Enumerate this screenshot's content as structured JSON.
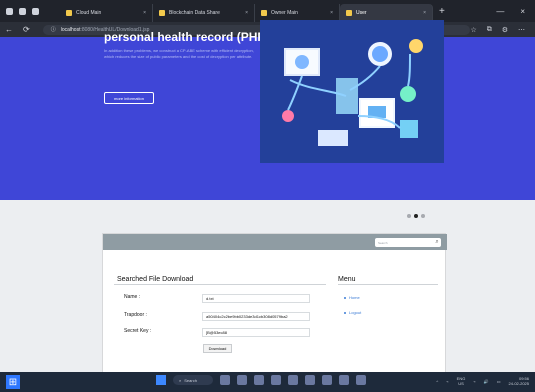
{
  "browser": {
    "tabs": [
      {
        "label": "Cloud Main",
        "active": false
      },
      {
        "label": "Blockchain Data Share",
        "active": false
      },
      {
        "label": "Owner Main",
        "active": false
      },
      {
        "label": "User",
        "active": true
      }
    ],
    "address": {
      "prefix": "localhost",
      "rest": ":8080/HealthUL/Download1.jsp"
    }
  },
  "hero": {
    "title": "personal health record (PHR)",
    "description": "In addition these problems, we construct a CP-ABE scheme with efficient decryption, which reduces the size of public parameters and the cost of decryption per attribute.",
    "button_label": "more information"
  },
  "content": {
    "search": {
      "placeholder": "Search"
    },
    "panel_title": "Searched File Download",
    "menu": {
      "title": "Menu",
      "items": [
        {
          "label": "Home"
        },
        {
          "label": "Logout"
        }
      ]
    },
    "fields": [
      {
        "label": "Name :",
        "value": "d.txt"
      },
      {
        "label": "Trapdoor :",
        "value": "a50404c2c2be9bb0233de3d1cb308d0579ba2"
      },
      {
        "label": "Secret Key :",
        "value": "[B@53ec88"
      }
    ],
    "download_label": "Download"
  },
  "taskbar": {
    "search_label": "Search",
    "language": "ENG\nUS",
    "time": "09:56",
    "date": "24-02-2025"
  }
}
